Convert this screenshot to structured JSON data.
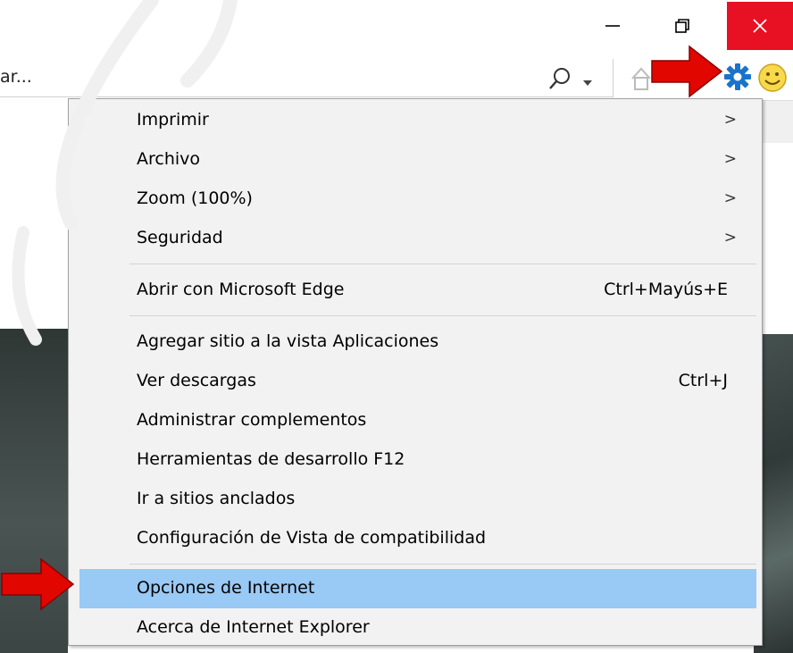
{
  "window": {
    "minimize_icon": "minimize-icon",
    "restore_icon": "restore-icon",
    "close_icon": "close-icon",
    "close_color": "#e81123"
  },
  "address_bar": {
    "text": "ar..."
  },
  "toolbar": {
    "search_icon": "search-icon",
    "home_icon": "home-icon",
    "gear_icon": "gear-icon",
    "smiley_icon": "smiley-icon",
    "gear_color": "#1a73c9"
  },
  "annotations": {
    "arrow_color": "#e10600"
  },
  "menu": {
    "items": [
      {
        "label": "Imprimir",
        "submenu": true
      },
      {
        "label": "Archivo",
        "submenu": true
      },
      {
        "label": "Zoom (100%)",
        "submenu": true
      },
      {
        "label": "Seguridad",
        "submenu": true
      },
      {
        "label": "Abrir con Microsoft Edge",
        "shortcut": "Ctrl+Mayús+E"
      },
      {
        "label": "Agregar sitio a la vista Aplicaciones"
      },
      {
        "label": "Ver descargas",
        "shortcut": "Ctrl+J"
      },
      {
        "label": "Administrar complementos"
      },
      {
        "label": "Herramientas de desarrollo F12"
      },
      {
        "label": "Ir a sitios anclados"
      },
      {
        "label": "Configuración de Vista de compatibilidad"
      },
      {
        "label": "Opciones de Internet",
        "highlighted": true
      },
      {
        "label": "Acerca de Internet Explorer"
      }
    ],
    "chevron": ">",
    "highlight_color": "#99c9f5"
  }
}
